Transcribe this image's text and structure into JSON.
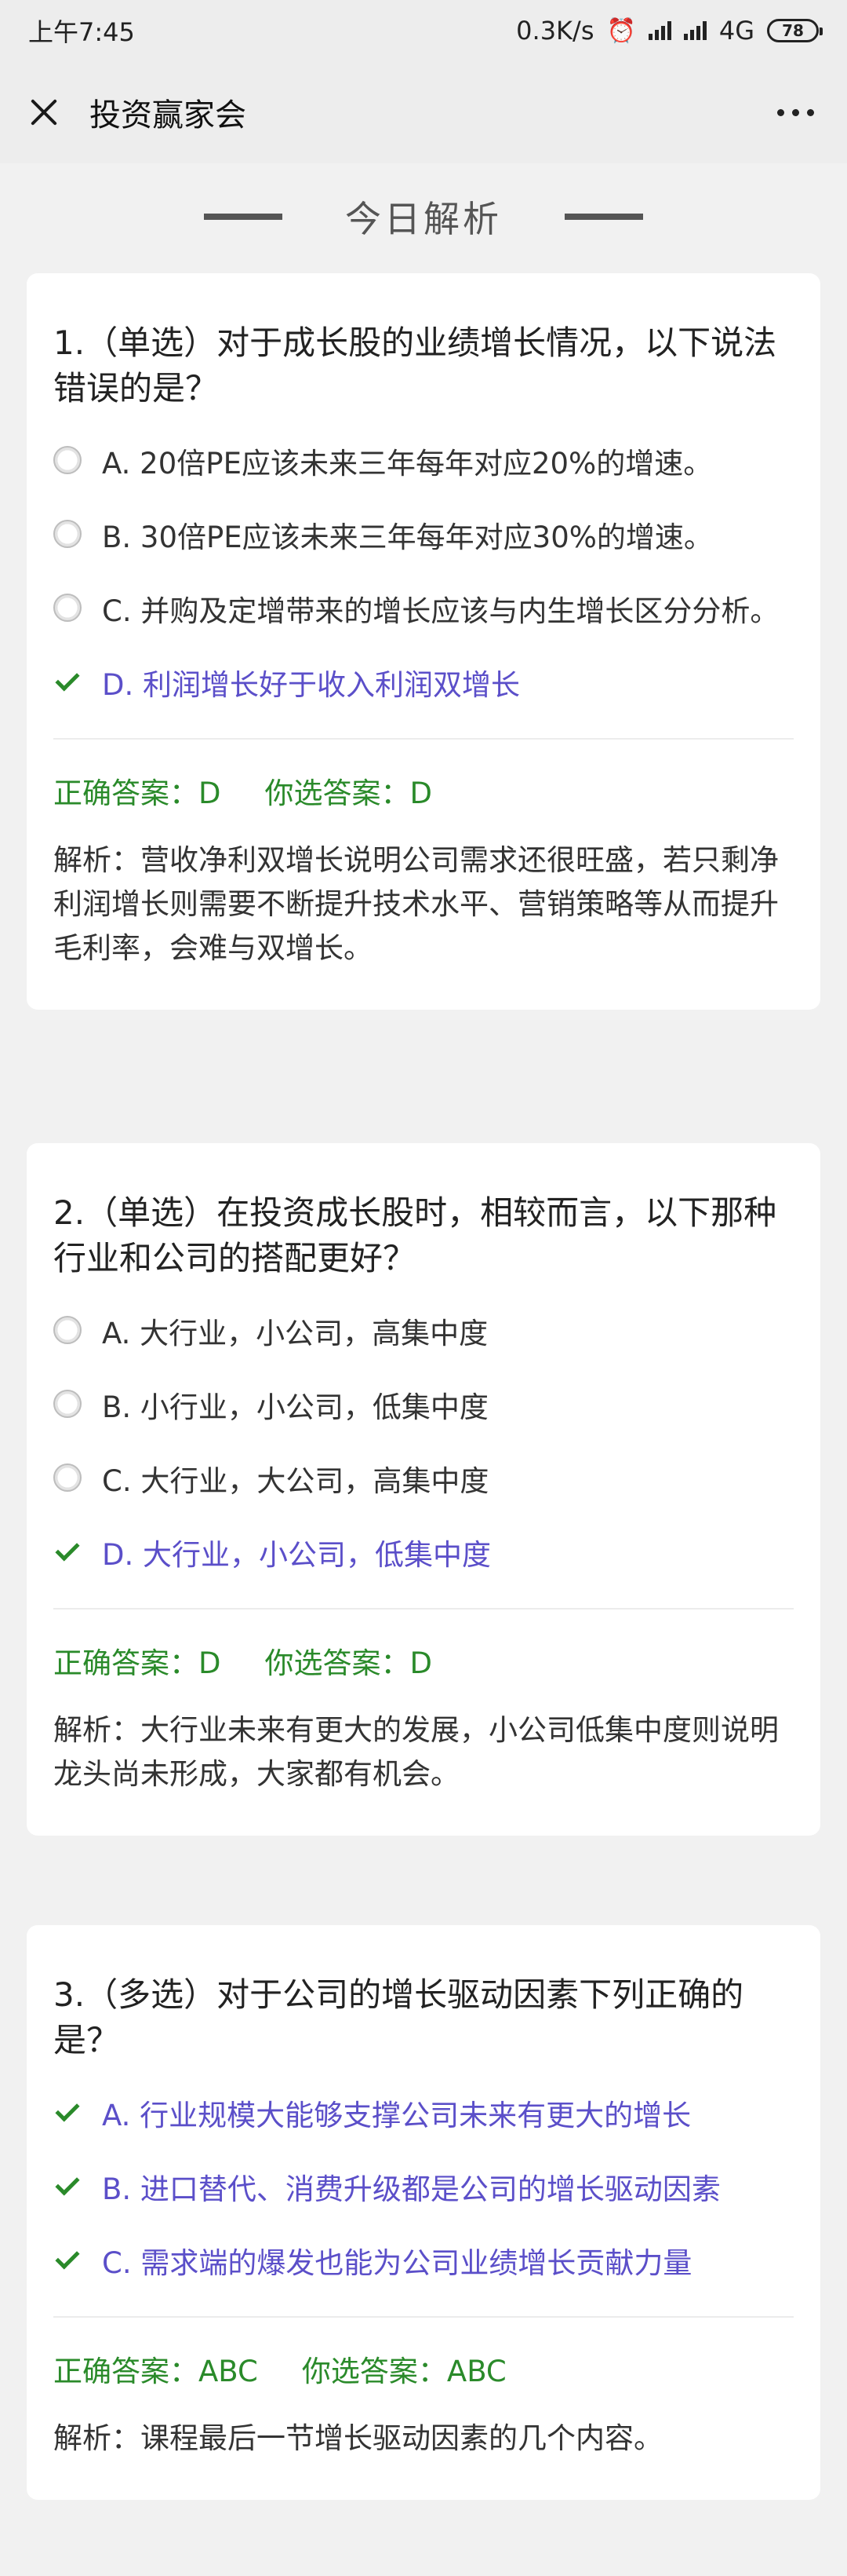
{
  "status": {
    "time": "上午7:45",
    "speed": "0.3K/s",
    "network": "4G",
    "battery": "78"
  },
  "nav": {
    "title": "投资赢家会",
    "close_icon": "close-icon",
    "more_icon": "more-dots-icon"
  },
  "section": {
    "title": "今日解析"
  },
  "questions": [
    {
      "title": "1.（单选）对于成长股的业绩增长情况，以下说法错误的是？",
      "options": [
        {
          "text": "A. 20倍PE应该未来三年每年对应20%的增速。",
          "state": "radio"
        },
        {
          "text": "B. 30倍PE应该未来三年每年对应30%的增速。",
          "state": "radio"
        },
        {
          "text": "C. 并购及定增带来的增长应该与内生增长区分分析。",
          "state": "radio"
        },
        {
          "text": "D. 利润增长好于收入利润双增长",
          "state": "correct"
        }
      ],
      "correct": "正确答案：D",
      "chosen": "你选答案：D",
      "analysis": "解析：营收净利双增长说明公司需求还很旺盛，若只剩净利润增长则需要不断提升技术水平、营销策略等从而提升毛利率，会难与双增长。"
    },
    {
      "title": "2.（单选）在投资成长股时，相较而言，以下那种行业和公司的搭配更好？",
      "options": [
        {
          "text": "A. 大行业，小公司，高集中度",
          "state": "radio"
        },
        {
          "text": "B. 小行业，小公司，低集中度",
          "state": "radio"
        },
        {
          "text": "C. 大行业，大公司，高集中度",
          "state": "radio"
        },
        {
          "text": "D. 大行业，小公司，低集中度",
          "state": "correct"
        }
      ],
      "correct": "正确答案：D",
      "chosen": "你选答案：D",
      "analysis": "解析：大行业未来有更大的发展，小公司低集中度则说明龙头尚未形成，大家都有机会。"
    },
    {
      "title": "3.（多选）对于公司的增长驱动因素下列正确的是？",
      "options": [
        {
          "text": "A. 行业规模大能够支撑公司未来有更大的增长",
          "state": "correct"
        },
        {
          "text": "B. 进口替代、消费升级都是公司的增长驱动因素",
          "state": "correct"
        },
        {
          "text": "C. 需求端的爆发也能为公司业绩增长贡献力量",
          "state": "correct"
        }
      ],
      "correct": "正确答案：ABC",
      "chosen": "你选答案：ABC",
      "analysis": "解析：课程最后一节增长驱动因素的几个内容。"
    }
  ],
  "colors": {
    "correct_option": "#5b4fc9",
    "answer_green": "#2a8a2a",
    "background": "#f1f1f1"
  }
}
